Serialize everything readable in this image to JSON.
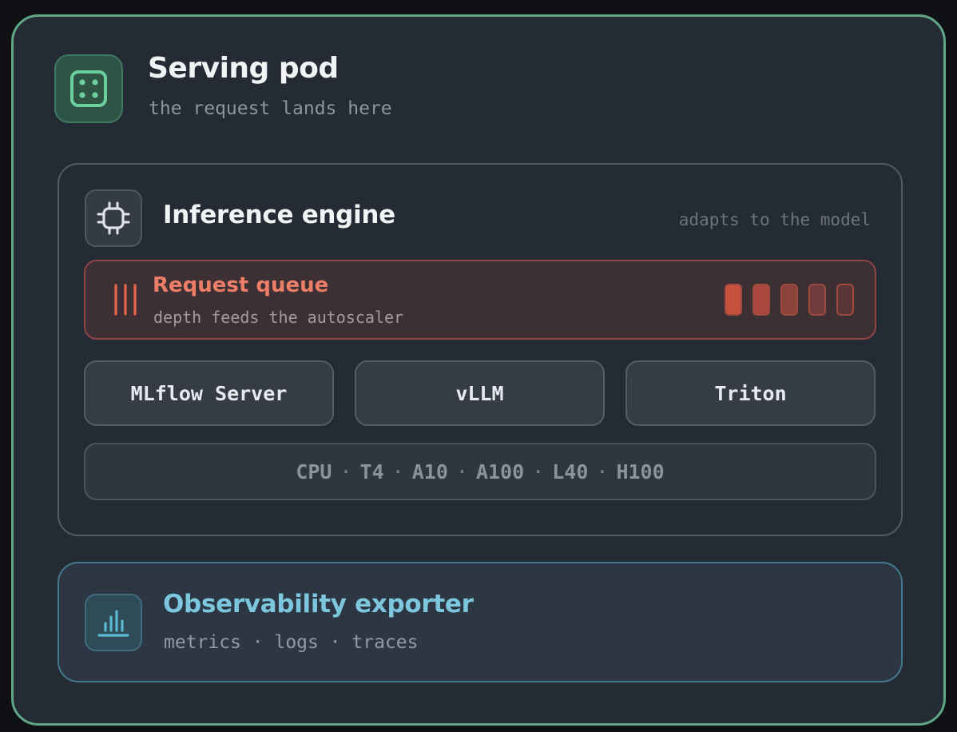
{
  "pod": {
    "icon": "server-grid-icon",
    "title": "Serving pod",
    "subtitle": "the request lands here"
  },
  "engine": {
    "icon": "cpu-chip-icon",
    "title": "Inference engine",
    "tag": "adapts to the model",
    "queue": {
      "icon": "queue-bars-icon",
      "title": "Request queue",
      "subtitle": "depth feeds the autoscaler",
      "slots_total": 5
    },
    "servers": [
      "MLflow Server",
      "vLLM",
      "Triton"
    ],
    "hardware": [
      "CPU",
      "T4",
      "A10",
      "A100",
      "L40",
      "H100"
    ],
    "hardware_separator": "·"
  },
  "observability": {
    "icon": "bar-chart-icon",
    "title": "Observability exporter",
    "subtitle": "metrics · logs · traces"
  },
  "colors": {
    "pod_border": "#5fa786",
    "queue_accent": "#ec7d66",
    "observability_accent": "#7cc6de"
  }
}
